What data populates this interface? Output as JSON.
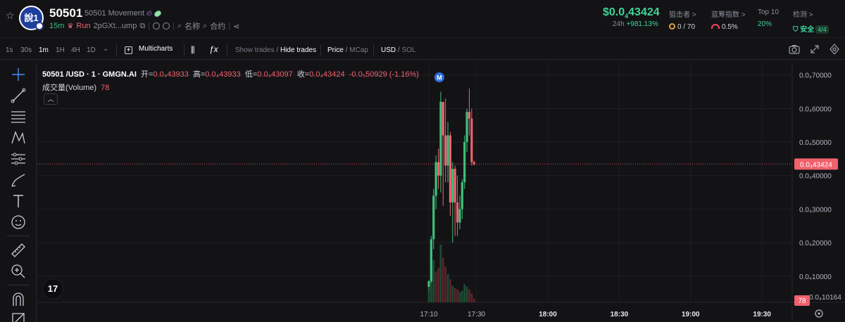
{
  "header": {
    "avatar_text": "說1",
    "symbol": "50501",
    "full_name": "50501 Movement",
    "age": "15m",
    "run_label": "Run",
    "address": "2pGXt...ump",
    "name_label": "名称",
    "contract_label": "合约",
    "price_prefix": "$0.0",
    "price_sub": "4",
    "price_suffix": "43424",
    "change_period": "24h",
    "change_value": "+981.13%"
  },
  "stats": {
    "snipers_label": "狙击者 >",
    "snipers_value": "0 / 70",
    "bluechip_label": "蓝筹指数 >",
    "bluechip_value": "0.5%",
    "top10_label": "Top 10",
    "top10_value": "20%",
    "check_label": "检测 >",
    "check_value": "安全",
    "check_badge": "4/4"
  },
  "toolbar": {
    "intervals": [
      "1s",
      "30s",
      "1m",
      "1H",
      "4H",
      "1D"
    ],
    "active_interval": "1m",
    "multicharts": "Multicharts",
    "show_trades": "Show trades",
    "hide_trades": "Hide trades",
    "price": "Price",
    "mcap": "MCap",
    "usd": "USD",
    "sol": "SOL"
  },
  "legend": {
    "title": "50501 /USD · 1 · GMGN.AI",
    "open_label": "开=",
    "open": "0.0₄43933",
    "high_label": "高=",
    "high": "0.0₄43933",
    "low_label": "低=",
    "low": "0.0₄43097",
    "close_label": "收=",
    "close": "0.0₄43424",
    "change": "-0.0₅50929 (-1.16%)",
    "volume_label": "成交量(Volume)",
    "volume_value": "78"
  },
  "chart_data": {
    "type": "candlestick",
    "yticks": [
      "0.0₄70000",
      "0.0₄60000",
      "0.0₄50000",
      "0.0₄40000",
      "0.0₄30000",
      "0.0₄20000",
      "0.0₄10000"
    ],
    "ytick_values": [
      7e-05,
      6e-05,
      5e-05,
      4e-05,
      3e-05,
      2e-05,
      1e-05
    ],
    "ylim": [
      2.2e-06,
      7.35e-05
    ],
    "xticks": [
      "17:10",
      "17:30",
      "18:00",
      "18:30",
      "19:00",
      "19:30"
    ],
    "xtick_minutes": [
      0,
      20,
      50,
      80,
      110,
      140
    ],
    "current_price_label": "0.0₄43424",
    "current_price": 4.3424e-05,
    "volume_label": "78",
    "partial_label": "0.0₄10164",
    "marker": "M",
    "candles": [
      {
        "t": 0,
        "o": 6.8e-06,
        "h": 8.8e-06,
        "l": 5.8e-06,
        "c": 8.5e-06
      },
      {
        "t": 1,
        "o": 8.5e-06,
        "h": 2.2e-05,
        "l": 8e-06,
        "c": 2.1e-05
      },
      {
        "t": 2,
        "o": 2.1e-05,
        "h": 3.6e-05,
        "l": 1.8e-05,
        "c": 3.4e-05
      },
      {
        "t": 3,
        "o": 3.4e-05,
        "h": 4.6e-05,
        "l": 3e-05,
        "c": 4.4e-05
      },
      {
        "t": 4,
        "o": 4.4e-05,
        "h": 4.8e-05,
        "l": 3.6e-05,
        "c": 4e-05
      },
      {
        "t": 5,
        "o": 4e-05,
        "h": 6.5e-05,
        "l": 3.5e-05,
        "c": 6.2e-05
      },
      {
        "t": 6,
        "o": 6.2e-05,
        "h": 6e-05,
        "l": 3.1e-05,
        "c": 5.2e-05
      },
      {
        "t": 7,
        "o": 5.2e-05,
        "h": 6.3e-05,
        "l": 3.8e-05,
        "c": 4.3e-05
      },
      {
        "t": 8,
        "o": 4.3e-05,
        "h": 5.6e-05,
        "l": 3.8e-05,
        "c": 5.2e-05
      },
      {
        "t": 9,
        "o": 5.2e-05,
        "h": 5.3e-05,
        "l": 2.8e-05,
        "c": 3.2e-05
      },
      {
        "t": 10,
        "o": 3.2e-05,
        "h": 4.4e-05,
        "l": 2e-05,
        "c": 4.2e-05
      },
      {
        "t": 11,
        "o": 4.2e-05,
        "h": 4.3e-05,
        "l": 2.2e-05,
        "c": 3.2e-05
      },
      {
        "t": 12,
        "o": 3.2e-05,
        "h": 4e-05,
        "l": 2.2e-05,
        "c": 2.6e-05
      },
      {
        "t": 13,
        "o": 2.6e-05,
        "h": 3.4e-05,
        "l": 2.4e-05,
        "c": 3e-05
      },
      {
        "t": 14,
        "o": 3e-05,
        "h": 3.9e-05,
        "l": 2.7e-05,
        "c": 3.8e-05
      },
      {
        "t": 15,
        "o": 3.8e-05,
        "h": 5.2e-05,
        "l": 3.6e-05,
        "c": 5e-05
      },
      {
        "t": 16,
        "o": 5e-05,
        "h": 6e-05,
        "l": 4.7e-05,
        "c": 5.9e-05
      },
      {
        "t": 17,
        "o": 5.9e-05,
        "h": 6.6e-05,
        "l": 5.2e-05,
        "c": 5.7e-05
      },
      {
        "t": 18,
        "o": 5.7e-05,
        "h": 6e-05,
        "l": 4.3e-05,
        "c": 4.4e-05
      },
      {
        "t": 19,
        "o": 4.4e-05,
        "h": 4.45e-05,
        "l": 4.3e-05,
        "c": 4.3424e-05
      }
    ],
    "volumes": [
      {
        "t": 0,
        "v": 20,
        "up": true
      },
      {
        "t": 1,
        "v": 60,
        "up": true
      },
      {
        "t": 2,
        "v": 66,
        "up": true
      },
      {
        "t": 3,
        "v": 48,
        "up": false
      },
      {
        "t": 4,
        "v": 54,
        "up": false
      },
      {
        "t": 5,
        "v": 90,
        "up": true
      },
      {
        "t": 6,
        "v": 70,
        "up": false
      },
      {
        "t": 7,
        "v": 56,
        "up": false
      },
      {
        "t": 8,
        "v": 44,
        "up": true
      },
      {
        "t": 9,
        "v": 36,
        "up": false
      },
      {
        "t": 10,
        "v": 26,
        "up": true
      },
      {
        "t": 11,
        "v": 22,
        "up": false
      },
      {
        "t": 12,
        "v": 20,
        "up": false
      },
      {
        "t": 13,
        "v": 16,
        "up": true
      },
      {
        "t": 14,
        "v": 18,
        "up": true
      },
      {
        "t": 15,
        "v": 28,
        "up": true
      },
      {
        "t": 16,
        "v": 24,
        "up": true
      },
      {
        "t": 17,
        "v": 20,
        "up": false
      },
      {
        "t": 18,
        "v": 14,
        "up": false
      },
      {
        "t": 19,
        "v": 6,
        "up": false
      }
    ]
  },
  "colors": {
    "up": "#3fbf7a",
    "down": "#f0616d",
    "accent_green": "#3dd598",
    "price_line": "#f0616d",
    "marker": "#2f6fe0"
  }
}
